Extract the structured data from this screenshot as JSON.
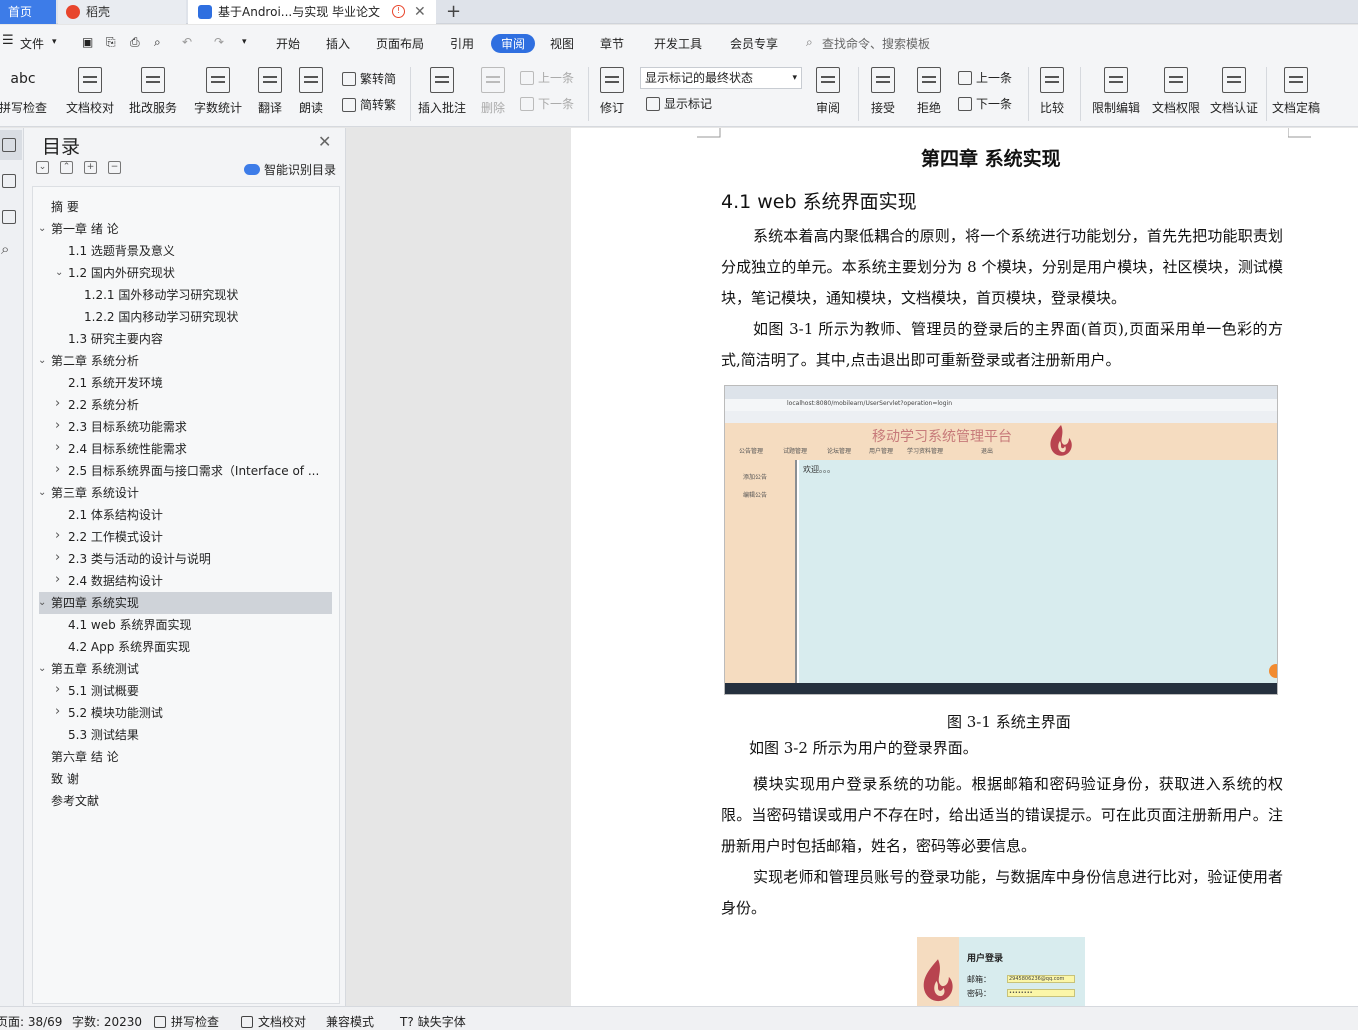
{
  "tabs": {
    "home": "首页",
    "daoke": "稻壳",
    "doc": "基于Androi...与实现 毕业论文",
    "new_tab": "+"
  },
  "menu": {
    "file": "文件",
    "items": [
      "开始",
      "插入",
      "页面布局",
      "引用",
      "审阅",
      "视图",
      "章节",
      "开发工具",
      "会员专享"
    ],
    "search_placeholder": "查找命令、搜索模板"
  },
  "ribbon": {
    "spell_check": "拼写检查",
    "doc_proof": "文档校对",
    "batch_service": "批改服务",
    "word_count": "字数统计",
    "translate": "翻译",
    "read_aloud": "朗读",
    "trad_to_simp": "繁转简",
    "simp_to_trad": "简转繁",
    "insert_comment": "插入批注",
    "delete": "删除",
    "prev_comment": "上一条",
    "next_comment": "下一条",
    "track_changes": "修订",
    "markup_select": "显示标记的最终状态",
    "show_markup": "显示标记",
    "review": "审阅",
    "accept": "接受",
    "reject": "拒绝",
    "prev_change": "上一条",
    "next_change": "下一条",
    "compare": "比较",
    "restrict_edit": "限制编辑",
    "doc_permission": "文档权限",
    "doc_certify": "文档认证",
    "doc_finalize": "文档定稿"
  },
  "toc": {
    "title": "目录",
    "smart_label": "智能识别目录",
    "items": [
      {
        "text": "摘  要",
        "level": 0,
        "chev": ""
      },
      {
        "text": "第一章  绪  论",
        "level": 0,
        "chev": "open"
      },
      {
        "text": "1.1 选题背景及意义",
        "level": 1,
        "chev": ""
      },
      {
        "text": "1.2 国内外研究现状",
        "level": 1,
        "chev": "open"
      },
      {
        "text": "1.2.1 国外移动学习研究现状",
        "level": 2,
        "chev": ""
      },
      {
        "text": "1.2.2 国内移动学习研究现状",
        "level": 2,
        "chev": ""
      },
      {
        "text": "1.3 研究主要内容",
        "level": 1,
        "chev": ""
      },
      {
        "text": "第二章  系统分析",
        "level": 0,
        "chev": "open"
      },
      {
        "text": "2.1 系统开发环境",
        "level": 1,
        "chev": ""
      },
      {
        "text": "2.2 系统分析",
        "level": 1,
        "chev": "closed"
      },
      {
        "text": "2.3 目标系统功能需求",
        "level": 1,
        "chev": "closed"
      },
      {
        "text": "2.4 目标系统性能需求",
        "level": 1,
        "chev": "closed"
      },
      {
        "text": "2.5 目标系统界面与接口需求（Interface of ...",
        "level": 1,
        "chev": "closed"
      },
      {
        "text": "第三章  系统设计",
        "level": 0,
        "chev": "open"
      },
      {
        "text": "2.1  体系结构设计",
        "level": 1,
        "chev": ""
      },
      {
        "text": "2.2  工作模式设计",
        "level": 1,
        "chev": "closed"
      },
      {
        "text": "2.3 类与活动的设计与说明",
        "level": 1,
        "chev": "closed"
      },
      {
        "text": "2.4 数据结构设计",
        "level": 1,
        "chev": "closed"
      },
      {
        "text": "第四章  系统实现",
        "level": 0,
        "chev": "open",
        "selected": true
      },
      {
        "text": "4.1 web 系统界面实现",
        "level": 1,
        "chev": ""
      },
      {
        "text": "4.2 App 系统界面实现",
        "level": 1,
        "chev": ""
      },
      {
        "text": "第五章  系统测试",
        "level": 0,
        "chev": "open"
      },
      {
        "text": "5.1 测试概要",
        "level": 1,
        "chev": "closed"
      },
      {
        "text": "5.2 模块功能测试",
        "level": 1,
        "chev": "closed"
      },
      {
        "text": "5.3  测试结果",
        "level": 1,
        "chev": ""
      },
      {
        "text": "第六章  结  论",
        "level": 0,
        "chev": ""
      },
      {
        "text": "致  谢",
        "level": 0,
        "chev": ""
      },
      {
        "text": "参考文献",
        "level": 0,
        "chev": ""
      }
    ]
  },
  "document": {
    "chapter_title": "第四章  系统实现",
    "section_title": "4.1 web 系统界面实现",
    "para1": "系统本着高内聚低耦合的原则，将一个系统进行功能划分，首先先把功能职责划分成独立的单元。本系统主要划分为 8 个模块，分别是用户模块，社区模块，测试模块，笔记模块，通知模块，文档模块，首页模块，登录模块。",
    "para2": "如图 3-1 所示为教师、管理员的登录后的主界面(首页),页面采用单一色彩的方式,简洁明了。其中,点击退出即可重新登录或者注册新用户。",
    "fig1_caption": "图 3-1  系统主界面",
    "para3": "如图 3-2 所示为用户的登录界面。",
    "para4": "模块实现用户登录系统的功能。根据邮箱和密码验证身份，获取进入系统的权限。当密码错误或用户不存在时，给出适当的错误提示。可在此页面注册新用户。注册新用户时包括邮箱，姓名，密码等必要信息。",
    "para5": "实现老师和管理员账号的登录功能，与数据库中身份信息进行比对，验证使用者身份。",
    "fig1": {
      "app_title": "移动学习系统管理平台",
      "url": "localhost:8080/mobilearn/UserServlet?operation=login",
      "nav": [
        "公告管理",
        "试题管理",
        "论坛管理",
        "用户管理",
        "学习资料管理",
        "退出"
      ],
      "side": [
        "添加公告",
        "编辑公告"
      ],
      "welcome": "欢迎。。。"
    },
    "fig2": {
      "title": "用户登录",
      "email_label": "邮箱：",
      "email_value": "2945806236@qq.com",
      "password_label": "密码：",
      "password_value": "••••••••"
    }
  },
  "status": {
    "page": "页面: 38/69",
    "words": "字数: 20230",
    "spell": "拼写检查",
    "proof": "文档校对",
    "compat": "兼容模式",
    "missing_font": "缺失字体"
  },
  "colors": {
    "accent": "#2f6fe0",
    "tab_home": "#3d7ce8",
    "app_header": "#f5dcc0",
    "app_content": "#d8ecee"
  }
}
